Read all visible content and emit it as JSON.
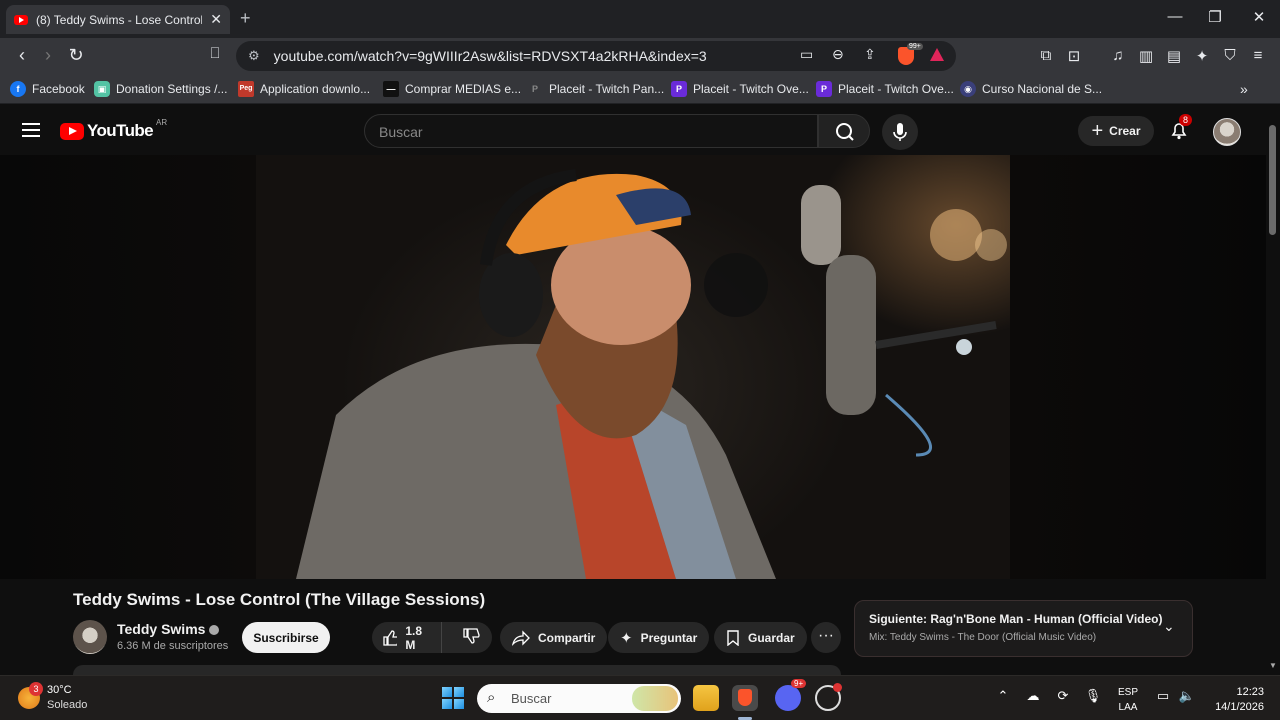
{
  "browser": {
    "tab_title": "(8) Teddy Swims - Lose Control (",
    "url": "youtube.com/watch?v=9gWIIIr2Asw&list=RDVSXT4a2kRHA&index=3",
    "brave_shield_count": "99+",
    "bookmarks": [
      {
        "label": "Facebook",
        "color": "#1877f2",
        "glyph": "f"
      },
      {
        "label": "Donation Settings /...",
        "color": "#53c3a4",
        "glyph": "▣"
      },
      {
        "label": "Application downlo...",
        "color": "#c0392b",
        "glyph": "Peg"
      },
      {
        "label": "Comprar MEDIAS e...",
        "color": "#111111",
        "glyph": "—"
      },
      {
        "label": "Placeit - Twitch Pan...",
        "color": "#555555",
        "glyph": "P"
      },
      {
        "label": "Placeit - Twitch Ove...",
        "color": "#6a2bd9",
        "glyph": "P"
      },
      {
        "label": "Placeit - Twitch Ove...",
        "color": "#6a2bd9",
        "glyph": "P"
      },
      {
        "label": "Curso Nacional de S...",
        "color": "#3a3f7a",
        "glyph": "◉"
      }
    ]
  },
  "youtube": {
    "logo_text": "YouTube",
    "country_code": "AR",
    "search_placeholder": "Buscar",
    "create_label": "Crear",
    "notification_count": "8"
  },
  "video": {
    "title": "Teddy Swims - Lose Control (The Village Sessions)",
    "channel_name": "Teddy Swims",
    "subscribers": "6.36 M de suscriptores",
    "subscribe_label": "Suscribirse",
    "likes": "1.8 M",
    "share_label": "Compartir",
    "ask_label": "Preguntar",
    "save_label": "Guardar"
  },
  "up_next": {
    "title": "Siguiente: Rag'n'Bone Man - Human (Official Video)",
    "subtitle": "Mix: Teddy Swims - The Door (Official Music Video)"
  },
  "taskbar": {
    "weather_badge": "3",
    "temperature": "30°C",
    "condition": "Soleado",
    "search_placeholder": "Buscar",
    "discord_badge": "9+",
    "language_line1": "ESP",
    "language_line2": "LAA",
    "time": "12:23",
    "date": "14/1/2026"
  }
}
